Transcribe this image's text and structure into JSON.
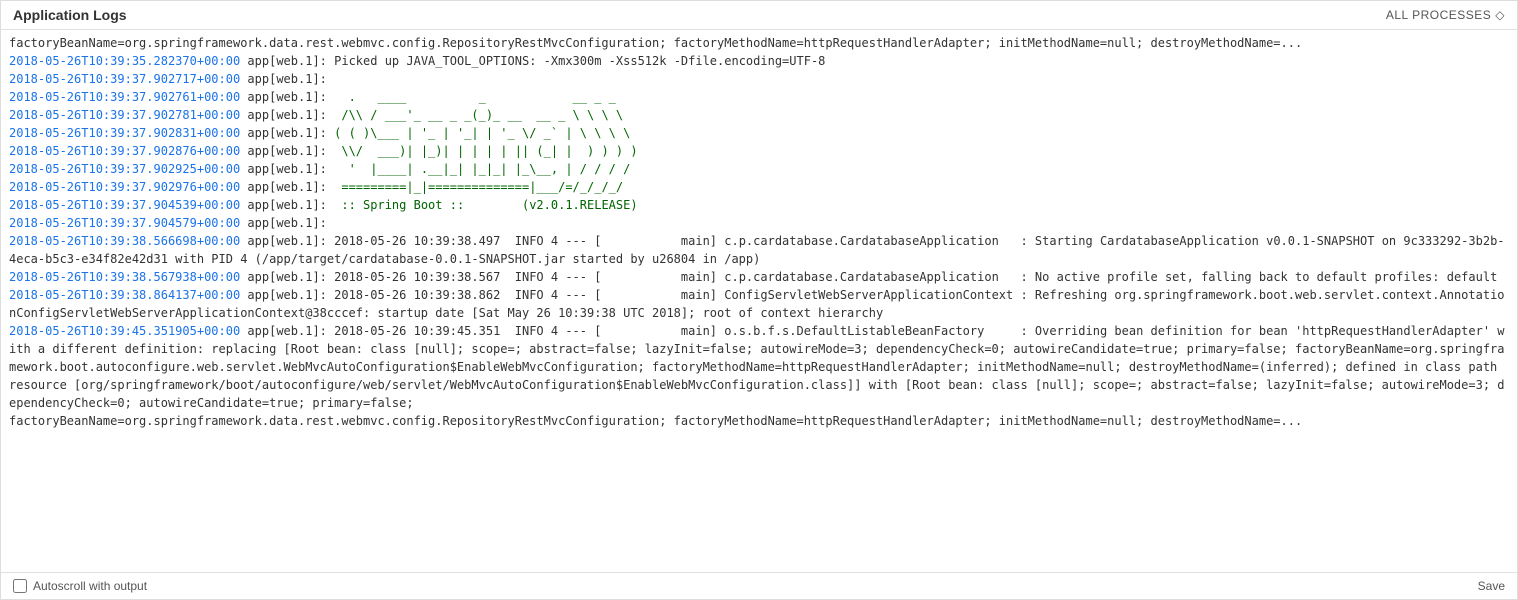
{
  "header": {
    "title": "Application Logs",
    "all_processes_label": "ALL PROCESSES"
  },
  "footer": {
    "autoscroll_label": "Autoscroll with output",
    "save_label": "Save"
  },
  "log_lines": [
    {
      "id": 1,
      "timestamp": "2018-05-26T10:39:35.282370+00:00",
      "process": "app[web.1]:",
      "message": " Picked up JAVA_TOOL_OPTIONS: -Xmx300m -Xss512k -Dfile.encoding=UTF-8",
      "type": "normal"
    },
    {
      "id": 2,
      "timestamp": "2018-05-26T10:39:37.902717+00:00",
      "process": "app[web.1]:",
      "message": "",
      "type": "normal"
    },
    {
      "id": 3,
      "timestamp": "2018-05-26T10:39:37.902761+00:00",
      "process": "app[web.1]:",
      "message": "   .   ____          _            __ _ _",
      "type": "ascii"
    },
    {
      "id": 4,
      "timestamp": "2018-05-26T10:39:37.902781+00:00",
      "process": "app[web.1]:",
      "message": "  /\\\\ / ___'_ __ _ _(_)_ __  __ _ \\ \\ \\ \\",
      "type": "ascii"
    },
    {
      "id": 5,
      "timestamp": "2018-05-26T10:39:37.902831+00:00",
      "process": "app[web.1]:",
      "message": " ( ( )\\___ | '_ | '_| | '_ \\/ _` | \\ \\ \\ \\",
      "type": "ascii"
    },
    {
      "id": 6,
      "timestamp": "2018-05-26T10:39:37.902876+00:00",
      "process": "app[web.1]:",
      "message": "  \\\\/  ___)| |_)| | | | | || (_| |  ) ) ) )",
      "type": "ascii"
    },
    {
      "id": 7,
      "timestamp": "2018-05-26T10:39:37.902925+00:00",
      "process": "app[web.1]:",
      "message": "   '  |____| .__|_| |_|_| |_\\__, | / / / /",
      "type": "ascii"
    },
    {
      "id": 8,
      "timestamp": "2018-05-26T10:39:37.902976+00:00",
      "process": "app[web.1]:",
      "message": "  =========|_|==============|___/=/_/_/_/",
      "type": "ascii"
    },
    {
      "id": 9,
      "timestamp": "2018-05-26T10:39:37.904539+00:00",
      "process": "app[web.1]:",
      "message": "  :: Spring Boot ::        (v2.0.1.RELEASE)",
      "type": "ascii"
    },
    {
      "id": 10,
      "timestamp": "2018-05-26T10:39:37.904579+00:00",
      "process": "app[web.1]:",
      "message": "",
      "type": "normal"
    },
    {
      "id": 11,
      "timestamp": "2018-05-26T10:39:38.566698+00:00",
      "process": "app[web.1]:",
      "message": " 2018-05-26 10:39:38.497  INFO 4 --- [           main] c.p.cardatabase.CardatabaseApplication   : Starting CardatabaseApplication v0.0.1-SNAPSHOT on 9c333292-3b2b-4eca-b5c3-e34f82e42d31 with PID 4 (/app/target/cardatabase-0.0.1-SNAPSHOT.jar started by u26804 in /app)",
      "type": "normal"
    },
    {
      "id": 12,
      "timestamp": "2018-05-26T10:39:38.567938+00:00",
      "process": "app[web.1]:",
      "message": " 2018-05-26 10:39:38.567  INFO 4 --- [           main] c.p.cardatabase.CardatabaseApplication   : No active profile set, falling back to default profiles: default",
      "type": "normal"
    },
    {
      "id": 13,
      "timestamp": "2018-05-26T10:39:38.864137+00:00",
      "process": "app[web.1]:",
      "message": " 2018-05-26 10:39:38.862  INFO 4 --- [           main] ConfigServletWebServerApplicationContext : Refreshing org.springframework.boot.web.servlet.context.AnnotationConfigServletWebServerApplicationContext@38cccef: startup date [Sat May 26 10:39:38 UTC 2018]; root of context hierarchy",
      "type": "normal"
    },
    {
      "id": 14,
      "timestamp": "2018-05-26T10:39:45.351905+00:00",
      "process": "app[web.1]:",
      "message": " 2018-05-26 10:39:45.351  INFO 4 --- [           main] o.s.b.f.s.DefaultListableBeanFactory     : Overriding bean definition for bean 'httpRequestHandlerAdapter' with a different definition: replacing [Root bean: class [null]; scope=; abstract=false; lazyInit=false; autowireMode=3; dependencyCheck=0; autowireCandidate=true; primary=false; factoryBeanName=org.springframework.boot.autoconfigure.web.servlet.WebMvcAutoConfiguration$EnableWebMvcConfiguration; factoryMethodName=httpRequestHandlerAdapter; initMethodName=null; destroyMethodName=(inferred); defined in class path resource [org/springframework/boot/autoconfigure/web/servlet/WebMvcAutoConfiguration$EnableWebMvcConfiguration.class]] with [Root bean: class [null]; scope=; abstract=false; lazyInit=false; autowireMode=3; dependencyCheck=0; autowireCandidate=true; primary=false;",
      "type": "normal"
    },
    {
      "id": 15,
      "timestamp": "",
      "process": "",
      "message": "factoryBeanName=org.springframework.data.rest.webmvc.config.RepositoryRestMvcConfiguration; factoryMethodName=httpRequestHandlerAdapter; initMethodName=null; destroyMethodName=...",
      "type": "continuation"
    }
  ]
}
